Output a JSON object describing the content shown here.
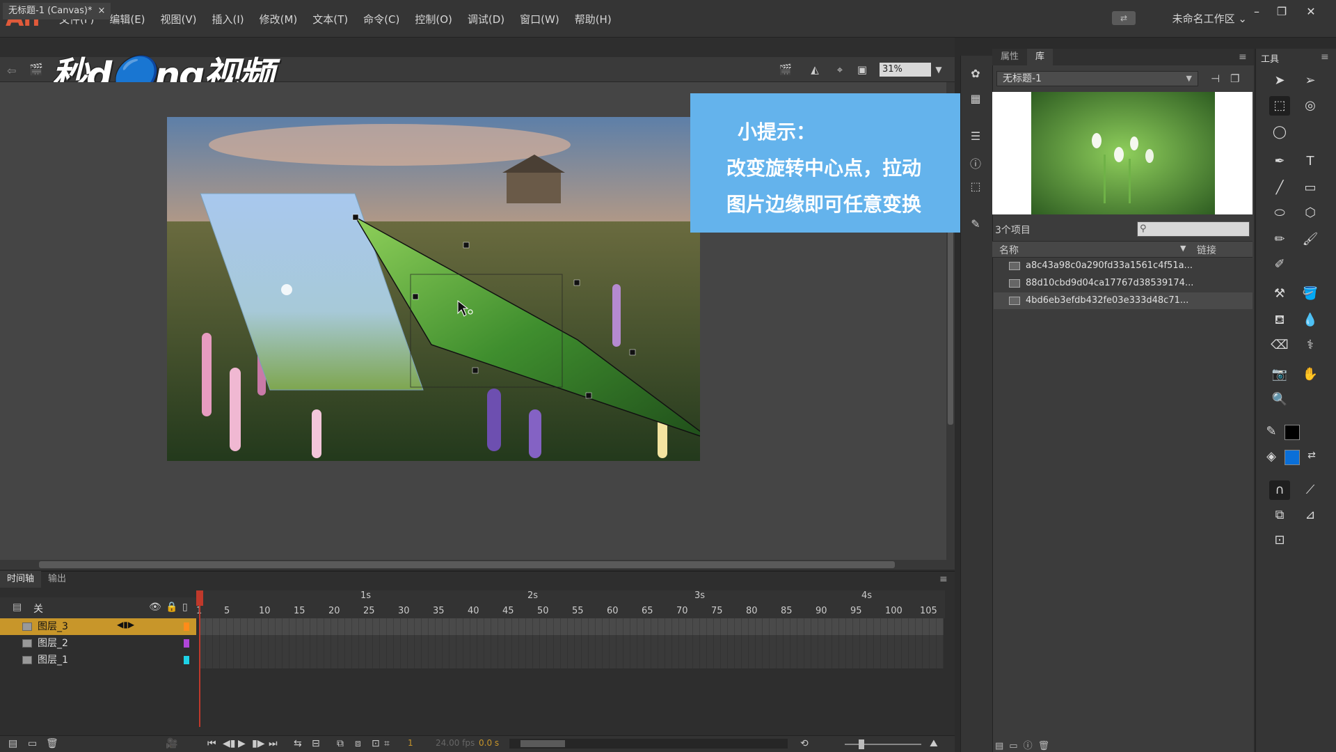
{
  "app": {
    "logo": "An",
    "menus": [
      "文件(F)",
      "编辑(E)",
      "视图(V)",
      "插入(I)",
      "修改(M)",
      "文本(T)",
      "命令(C)",
      "控制(O)",
      "调试(D)",
      "窗口(W)",
      "帮助(H)"
    ],
    "workspace": "未命名工作区",
    "sync_icon": "sync-settings-icon"
  },
  "document": {
    "tab_title": "无标题-1 (Canvas)*",
    "tab_close": "×",
    "zoom": "31%",
    "watermark": "秒d🔵ng视频"
  },
  "tip": {
    "title": "小提示：",
    "line1": "改变旋转中心点，拉动",
    "line2": "图片边缘即可任意变换"
  },
  "library": {
    "tabs": [
      "属性",
      "库"
    ],
    "active_tab": "库",
    "document_select": "无标题-1",
    "item_count": "3个项目",
    "search_placeholder": "",
    "col_name": "名称",
    "col_link": "链接",
    "items": [
      "a8c43a98c0a290fd33a1561c4f51a...",
      "88d10cbd9d04ca17767d38539174...",
      "4bd6eb3efdb432fe03e333d48c71..."
    ]
  },
  "tools": {
    "title": "工具"
  },
  "timeline": {
    "tabs": [
      "时间轴",
      "输出"
    ],
    "active_tab": "时间轴",
    "header_label": "关",
    "layers": [
      {
        "name": "图层_3",
        "color": "#ff8c1a",
        "selected": true
      },
      {
        "name": "图层_2",
        "color": "#b046d8",
        "selected": false
      },
      {
        "name": "图层_1",
        "color": "#1ed2e6",
        "selected": false
      }
    ],
    "frame_ticks": [
      "1",
      "5",
      "10",
      "15",
      "20",
      "25",
      "30",
      "35",
      "40",
      "45",
      "50",
      "55",
      "60",
      "65",
      "70",
      "75",
      "80",
      "85",
      "90",
      "95",
      "100",
      "105"
    ],
    "seconds": [
      "1s",
      "2s",
      "3s",
      "4s"
    ],
    "current_frame": "1",
    "fps": "24.00 fps",
    "time": "0.0 s"
  },
  "colors": {
    "accent_layer": "#c8962a",
    "tip_bg": "#64b3ec",
    "fill": "#0a6fd8",
    "stroke": "#000000"
  }
}
